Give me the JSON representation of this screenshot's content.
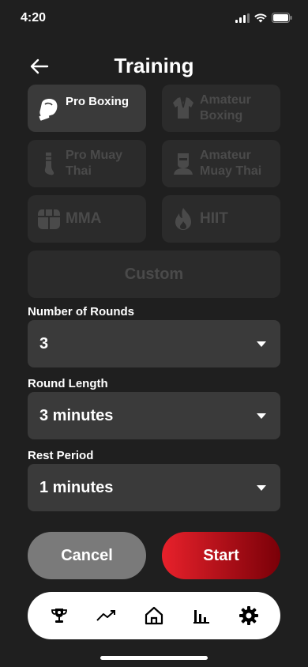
{
  "status": {
    "time": "4:20"
  },
  "header": {
    "title": "Training"
  },
  "workouts": [
    {
      "label": "Pro Boxing",
      "icon": "boxing-glove-icon"
    },
    {
      "label": "Amateur Boxing",
      "icon": "gi-uniform-icon"
    },
    {
      "label": "Pro Muay Thai",
      "icon": "shin-guard-icon"
    },
    {
      "label": "Amateur Muay Thai",
      "icon": "fighter-mask-icon"
    },
    {
      "label": "MMA",
      "icon": "mma-glove-icon"
    },
    {
      "label": "HIIT",
      "icon": "flame-icon"
    },
    {
      "label": "Custom"
    }
  ],
  "fields": {
    "rounds": {
      "label": "Number of Rounds",
      "value": "3"
    },
    "round_length": {
      "label": "Round Length",
      "value": "3 minutes"
    },
    "rest": {
      "label": "Rest Period",
      "value": "1 minutes"
    }
  },
  "actions": {
    "cancel": "Cancel",
    "start": "Start"
  },
  "nav": [
    "trophy-icon",
    "trend-icon",
    "home-icon",
    "stats-icon",
    "settings-icon"
  ],
  "colors": {
    "accent": "#e8212b",
    "background": "#1f1f1f",
    "tile": "#2b2b2b",
    "field": "#3a3a3a"
  }
}
